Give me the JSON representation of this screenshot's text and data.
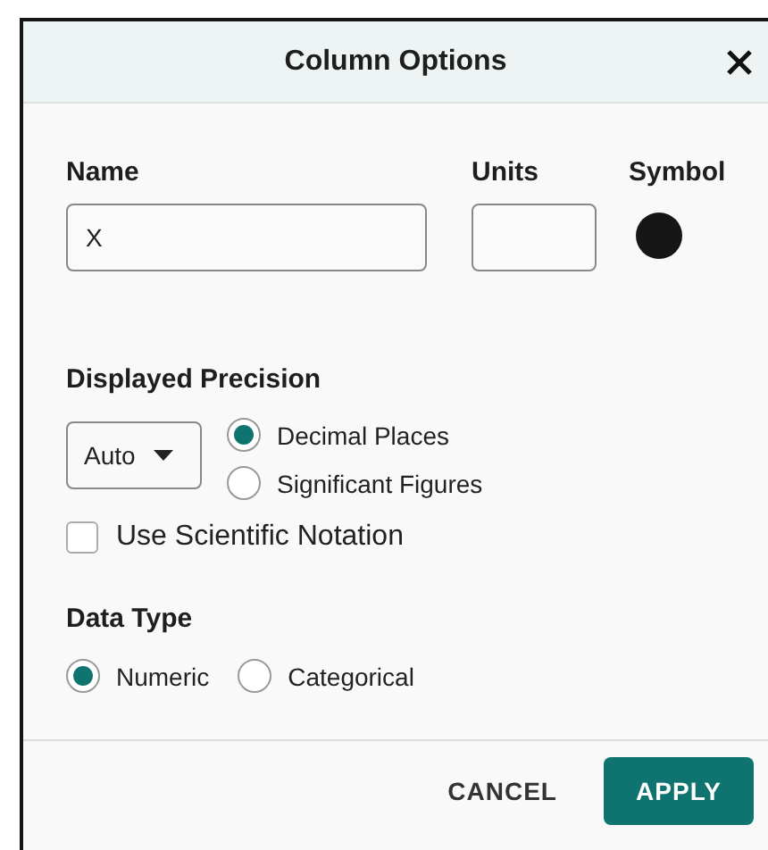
{
  "dialog": {
    "title": "Column Options"
  },
  "fields": {
    "name": {
      "label": "Name",
      "value": "X"
    },
    "units": {
      "label": "Units"
    },
    "symbol": {
      "label": "Symbol"
    }
  },
  "precision": {
    "label": "Displayed Precision",
    "dropdown": "Auto",
    "options": [
      {
        "label": "Decimal Places",
        "selected": true
      },
      {
        "label": "Significant Figures",
        "selected": false
      }
    ],
    "scientific": {
      "label": "Use Scientific Notation",
      "checked": false
    }
  },
  "data_type": {
    "label": "Data Type",
    "options": [
      {
        "label": "Numeric",
        "selected": true
      },
      {
        "label": "Categorical",
        "selected": false
      }
    ]
  },
  "buttons": [
    {
      "label": "CANCEL",
      "kind": "text"
    },
    {
      "label": "APPLY",
      "kind": "primary"
    }
  ]
}
